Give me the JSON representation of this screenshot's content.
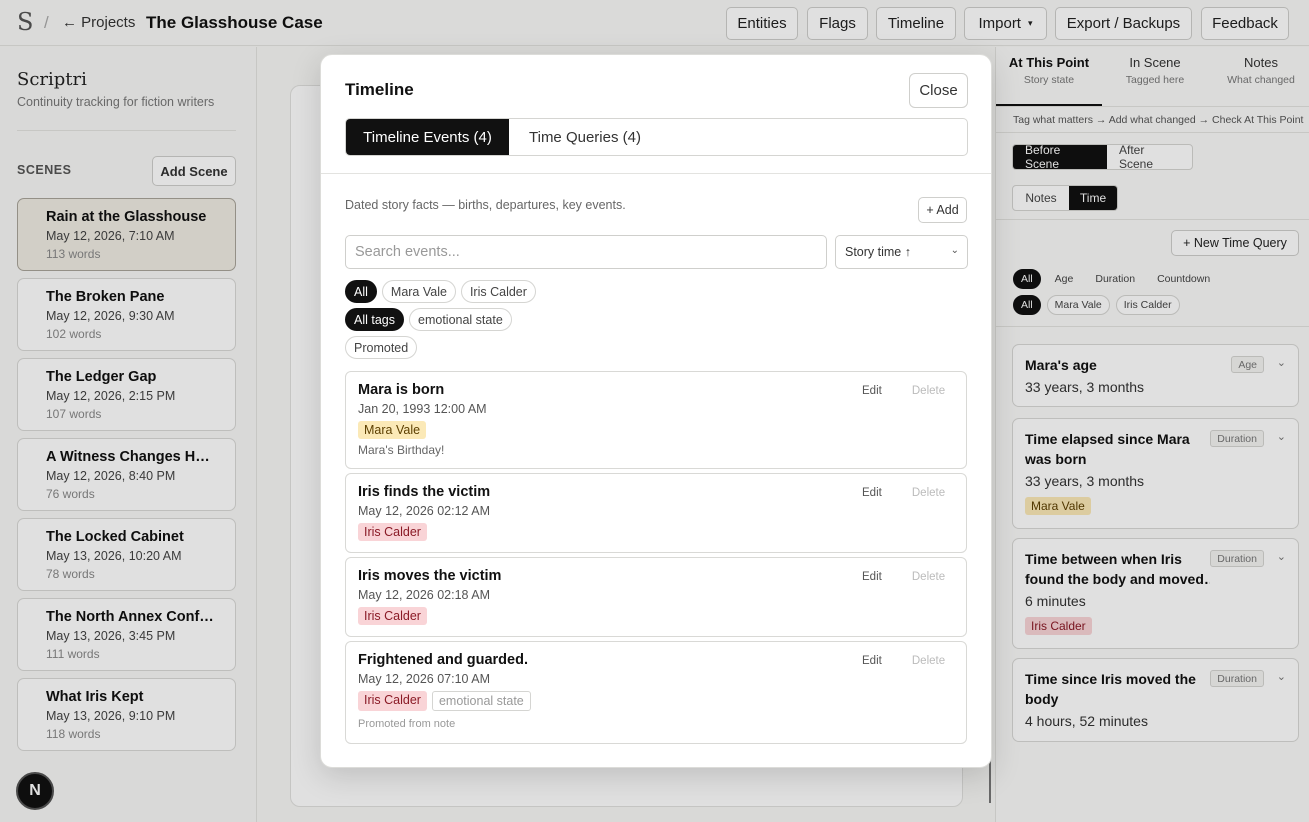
{
  "topbar": {
    "logo": "S",
    "separator": "/",
    "back_link": "← Projects",
    "project_title": "The Glasshouse Case",
    "buttons": {
      "entities": "Entities",
      "flags": "Flags",
      "timeline": "Timeline",
      "import": "Import",
      "import_caret": "▾",
      "export": "Export / Backups",
      "feedback": "Feedback"
    }
  },
  "sidebar": {
    "brand_name": "Scriptri",
    "brand_tagline": "Continuity tracking for fiction writers",
    "scenes_heading": "SCENES",
    "add_scene": "Add Scene",
    "scenes": [
      {
        "title": "Rain at the Glasshouse",
        "date": "May 12, 2026, 7:10 AM",
        "words": "113 words"
      },
      {
        "title": "The Broken Pane",
        "date": "May 12, 2026, 9:30 AM",
        "words": "102 words"
      },
      {
        "title": "The Ledger Gap",
        "date": "May 12, 2026, 2:15 PM",
        "words": "107 words"
      },
      {
        "title": "A Witness Changes H…",
        "date": "May 12, 2026, 8:40 PM",
        "words": "76 words"
      },
      {
        "title": "The Locked Cabinet",
        "date": "May 13, 2026, 10:20 AM",
        "words": "78 words"
      },
      {
        "title": "The North Annex Conf…",
        "date": "May 13, 2026, 3:45 PM",
        "words": "111 words"
      },
      {
        "title": "What Iris Kept",
        "date": "May 13, 2026, 9:10 PM",
        "words": "118 words"
      }
    ],
    "badge": "N"
  },
  "right_panel": {
    "tabs": [
      {
        "title": "At This Point",
        "sub": "Story state"
      },
      {
        "title": "In Scene",
        "sub": "Tagged here"
      },
      {
        "title": "Notes",
        "sub": "What changed"
      }
    ],
    "hint": "Tag what matters → Add what changed → Check At This Point",
    "scene_toggle": {
      "before": "Before Scene",
      "after": "After Scene"
    },
    "view_toggle": {
      "notes": "Notes",
      "time": "Time"
    },
    "new_query": "+ New Time Query",
    "type_filters": [
      "All",
      "Age",
      "Duration",
      "Countdown"
    ],
    "char_filters": [
      "All",
      "Mara Vale",
      "Iris Calder"
    ],
    "queries": [
      {
        "title": "Mara's age",
        "value": "33 years, 3 months",
        "type": "Age",
        "tag": ""
      },
      {
        "title": "Time elapsed since Mara was born",
        "value": "33 years, 3 months",
        "type": "Duration",
        "tag": "Mara Vale"
      },
      {
        "title": "Time between when Iris found the body and moved…",
        "value": "6 minutes",
        "type": "Duration",
        "tag": "Iris Calder"
      },
      {
        "title": "Time since Iris moved the body",
        "value": "4 hours, 52 minutes",
        "type": "Duration",
        "tag": ""
      }
    ],
    "chevron": "⌄"
  },
  "modal": {
    "title": "Timeline",
    "close": "Close",
    "tabs": {
      "events": "Timeline Events (4)",
      "queries": "Time Queries (4)"
    },
    "description": "Dated story facts — births, departures, key events.",
    "add": "+ Add",
    "search_placeholder": "Search events...",
    "sort": "Story time ↑",
    "sort_caret": "⌄",
    "char_filters": [
      "All",
      "Mara Vale",
      "Iris Calder"
    ],
    "tag_filters": [
      "All tags",
      "emotional state"
    ],
    "promoted_filter": "Promoted",
    "edit_label": "Edit",
    "delete_label": "Delete",
    "events": [
      {
        "title": "Mara is born",
        "date": "Jan 20, 1993 12:00 AM",
        "tag": "Mara Vale",
        "note": "Mara's Birthday!"
      },
      {
        "title": "Iris finds the victim",
        "date": "May 12, 2026 02:12 AM",
        "tag": "Iris Calder"
      },
      {
        "title": "Iris moves the victim",
        "date": "May 12, 2026 02:18 AM",
        "tag": "Iris Calder"
      },
      {
        "title": "Frightened and guarded.",
        "date": "May 12, 2026 07:10 AM",
        "tag": "Iris Calder",
        "tag2": "emotional state",
        "promoted": "Promoted from note"
      }
    ]
  },
  "colors": {
    "mara_tag_bg": "#fbe9b7",
    "iris_tag_bg": "#f9d4d7",
    "active_dark": "#111111"
  }
}
